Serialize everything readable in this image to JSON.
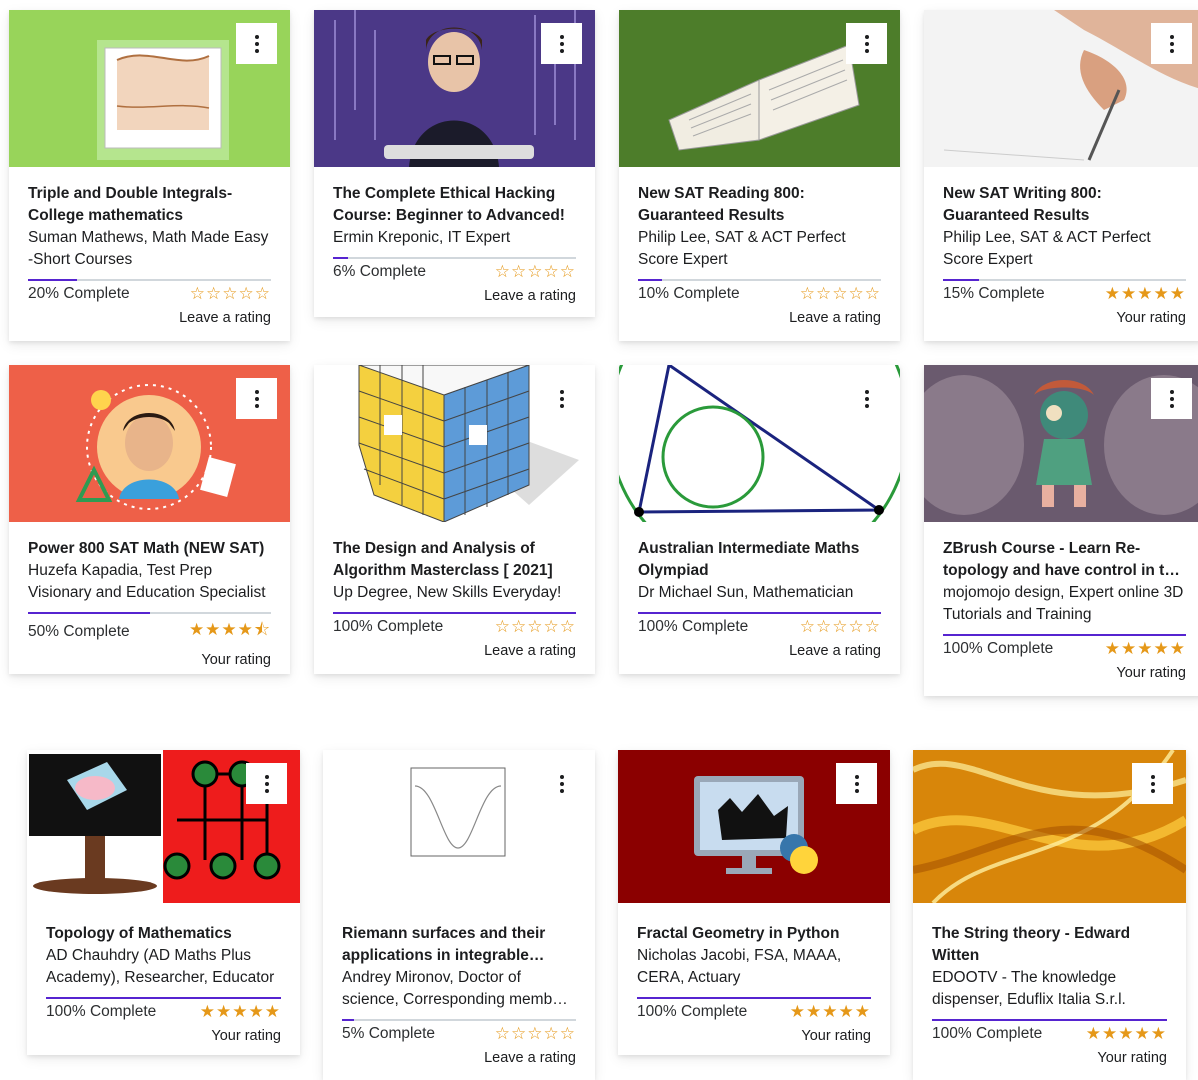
{
  "colors": {
    "accent": "#5624d0",
    "star": "#e59819"
  },
  "courses": [
    {
      "title": "Triple and Double Integrals-College mathematics",
      "instructor": "Suman Mathews, Math Made Easy -Short Courses",
      "progress": 20,
      "progress_label": "20% Complete",
      "stars": "☆☆☆☆☆",
      "rating_label": "Leave a rating"
    },
    {
      "title": "The Complete Ethical Hacking Course: Beginner to Advanced!",
      "instructor": "Ermin Kreponic, IT Expert",
      "progress": 6,
      "progress_label": "6% Complete",
      "stars": "☆☆☆☆☆",
      "rating_label": "Leave a rating"
    },
    {
      "title": "New SAT Reading 800: Guaranteed Results",
      "instructor": "Philip Lee, SAT & ACT Perfect Score Expert",
      "progress": 10,
      "progress_label": "10% Complete",
      "stars": "☆☆☆☆☆",
      "rating_label": "Leave a rating"
    },
    {
      "title": "New SAT Writing 800: Guaranteed Results",
      "instructor": "Philip Lee, SAT & ACT Perfect Score Expert",
      "progress": 15,
      "progress_label": "15% Complete",
      "stars": "★★★★★",
      "rating_label": "Your rating"
    },
    {
      "title": "Power 800 SAT Math (NEW SAT)",
      "instructor": "Huzefa Kapadia, Test Prep Visionary and Education Specialist",
      "progress": 50,
      "progress_label": "50% Complete",
      "stars": "★★★★⯪",
      "rating_label": "Your rating"
    },
    {
      "title": "The Design and Analysis of Algorithm Masterclass [ 2021]",
      "instructor": "Up Degree, New Skills Everyday!",
      "progress": 100,
      "progress_label": "100% Complete",
      "stars": "☆☆☆☆☆",
      "rating_label": "Leave a rating"
    },
    {
      "title": "Australian Intermediate Maths Olympiad",
      "instructor": "Dr Michael Sun, Mathematician",
      "progress": 100,
      "progress_label": "100% Complete",
      "stars": "☆☆☆☆☆",
      "rating_label": "Leave a rating"
    },
    {
      "title": "ZBrush Course - Learn Re-topology and have control in the flow",
      "instructor": "mojomojo design, Expert online 3D Tutorials and Training",
      "progress": 100,
      "progress_label": "100% Complete",
      "stars": "★★★★★",
      "rating_label": "Your rating"
    },
    {
      "title": "Topology of Mathematics",
      "instructor": "AD Chauhdry (AD Maths Plus Academy), Researcher, Educator",
      "progress": 100,
      "progress_label": "100% Complete",
      "stars": "★★★★★",
      "rating_label": "Your rating"
    },
    {
      "title": "Riemann surfaces and their applications in integrable systems",
      "instructor": "Andrey Mironov, Doctor of science, Corresponding member of RAS",
      "progress": 5,
      "progress_label": "5% Complete",
      "stars": "☆☆☆☆☆",
      "rating_label": "Leave a rating"
    },
    {
      "title": "Fractal Geometry in Python",
      "instructor": "Nicholas Jacobi, FSA, MAAA, CERA, Actuary",
      "progress": 100,
      "progress_label": "100% Complete",
      "stars": "★★★★★",
      "rating_label": "Your rating"
    },
    {
      "title": "The String theory - Edward Witten",
      "instructor": "EDOOTV - The knowledge dispenser, Eduflix Italia S.r.l.",
      "progress": 100,
      "progress_label": "100% Complete",
      "stars": "★★★★★",
      "rating_label": "Your rating"
    }
  ]
}
